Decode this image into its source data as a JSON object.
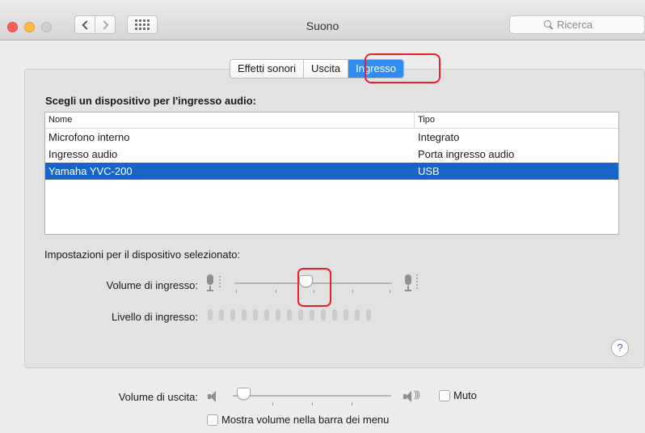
{
  "window": {
    "title": "Suono",
    "search_placeholder": "Ricerca"
  },
  "tabs": [
    {
      "label": "Effetti sonori",
      "active": false
    },
    {
      "label": "Uscita",
      "active": false
    },
    {
      "label": "Ingresso",
      "active": true
    }
  ],
  "input": {
    "device_heading": "Scegli un dispositivo per l'ingresso audio:",
    "columns": {
      "name": "Nome",
      "type": "Tipo"
    },
    "devices": [
      {
        "name": "Microfono interno",
        "type": "Integrato",
        "selected": false
      },
      {
        "name": "Ingresso audio",
        "type": "Porta ingresso audio",
        "selected": false
      },
      {
        "name": "Yamaha YVC-200",
        "type": "USB",
        "selected": true
      }
    ],
    "settings_heading": "Impostazioni per il dispositivo selezionato:",
    "volume_label": "Volume di ingresso:",
    "volume_fraction": 0.45,
    "level_label": "Livello di ingresso:",
    "level_segments": 15,
    "level_active": 0
  },
  "output": {
    "volume_label": "Volume di uscita:",
    "volume_fraction": 0.03,
    "mute_label": "Muto",
    "mute_checked": false,
    "menubar_label": "Mostra volume nella barra dei menu",
    "menubar_checked": false
  },
  "help_glyph": "?",
  "colors": {
    "accent": "#2f8cf0",
    "selection": "#1a64c9",
    "highlight": "#e8202a"
  }
}
